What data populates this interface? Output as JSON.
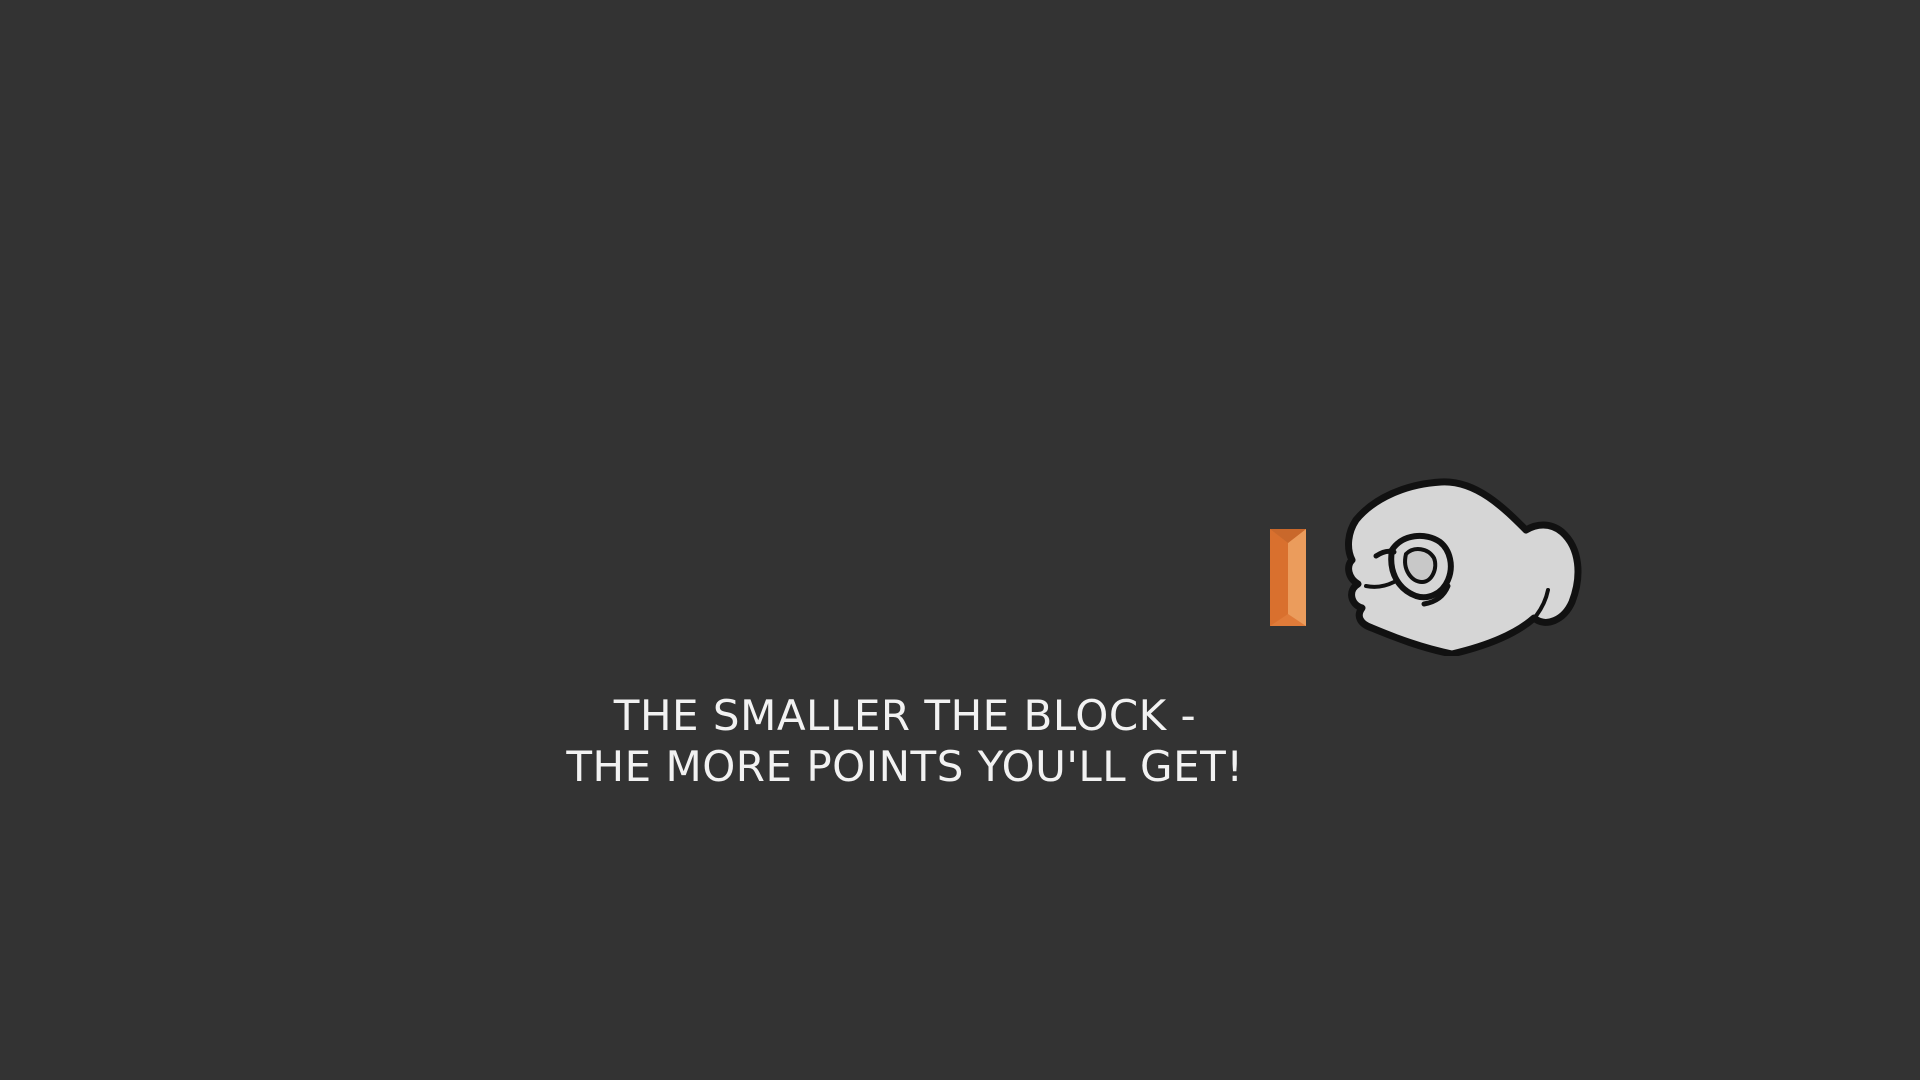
{
  "tutorial": {
    "line1": "THE SMALLER THE BLOCK -",
    "line2": "THE MORE POINTS YOU'LL GET!"
  },
  "colors": {
    "background": "#333333",
    "block_main": "#e07b39",
    "block_highlight": "#eb9c5c",
    "hand_fill": "#d6d6d6",
    "hand_outline": "#111111",
    "text": "#f2f2f2"
  },
  "icons": {
    "hand": "pinch-hand-icon",
    "block": "small-block"
  }
}
